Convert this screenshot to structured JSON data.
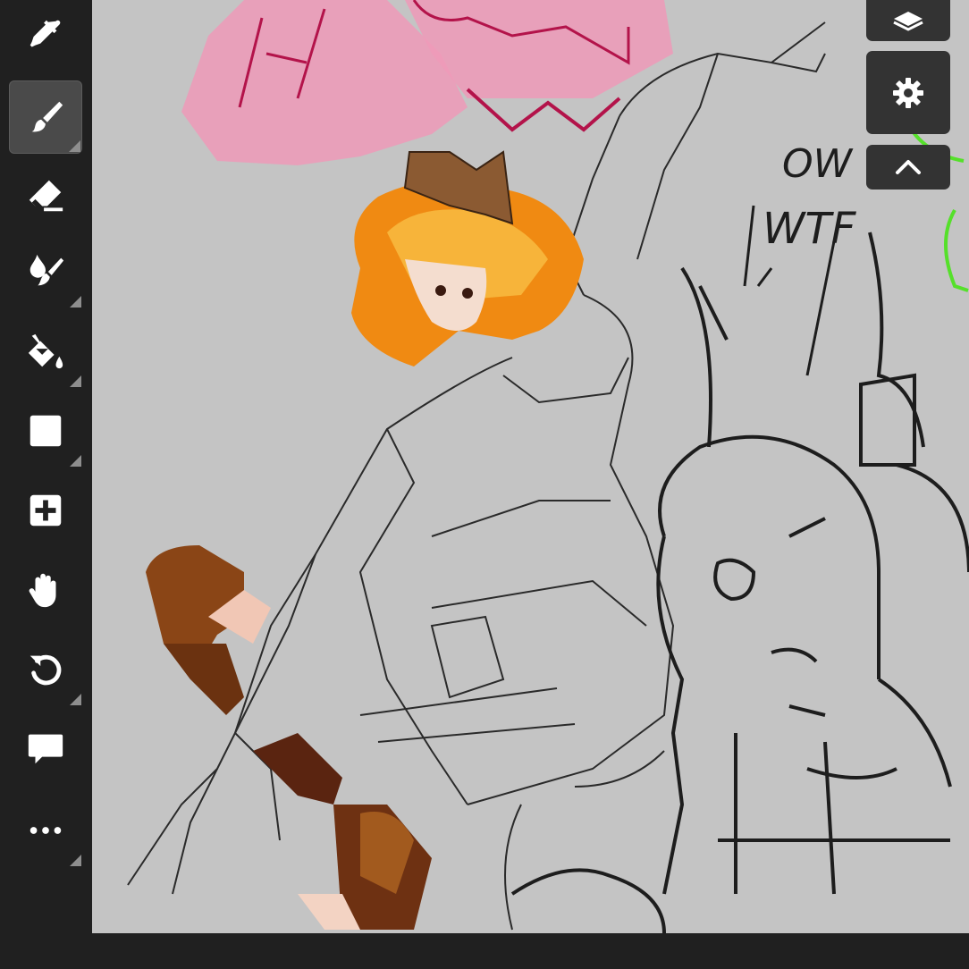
{
  "app": {
    "accent_color": "#4a4a4a",
    "canvas_background": "#c4c4c4",
    "toolbar_background": "#202020"
  },
  "toolbar": {
    "tools": [
      {
        "name": "eyedropper",
        "icon": "eyedropper-icon",
        "active": false,
        "has_submenu": false
      },
      {
        "name": "brush",
        "icon": "brush-icon",
        "active": true,
        "has_submenu": true
      },
      {
        "name": "eraser",
        "icon": "eraser-icon",
        "active": false,
        "has_submenu": false
      },
      {
        "name": "smudge",
        "icon": "smudge-icon",
        "active": false,
        "has_submenu": true
      },
      {
        "name": "fill",
        "icon": "paint-bucket-icon",
        "active": false,
        "has_submenu": true
      },
      {
        "name": "shape",
        "icon": "square-icon",
        "active": false,
        "has_submenu": true
      },
      {
        "name": "add",
        "icon": "plus-icon",
        "active": false,
        "has_submenu": false
      },
      {
        "name": "pan",
        "icon": "hand-icon",
        "active": false,
        "has_submenu": false
      },
      {
        "name": "undo",
        "icon": "undo-icon",
        "active": false,
        "has_submenu": true
      },
      {
        "name": "comment",
        "icon": "speech-bubble-icon",
        "active": false,
        "has_submenu": false
      },
      {
        "name": "more",
        "icon": "more-dots-icon",
        "active": false,
        "has_submenu": true
      }
    ]
  },
  "right_panel": {
    "buttons": [
      {
        "name": "layers",
        "icon": "layers-icon"
      },
      {
        "name": "settings",
        "icon": "gear-icon"
      },
      {
        "name": "collapse",
        "icon": "chevron-up-icon"
      }
    ]
  },
  "canvas": {
    "sketch_text": {
      "line1": "OW",
      "line2": "WTF"
    }
  }
}
